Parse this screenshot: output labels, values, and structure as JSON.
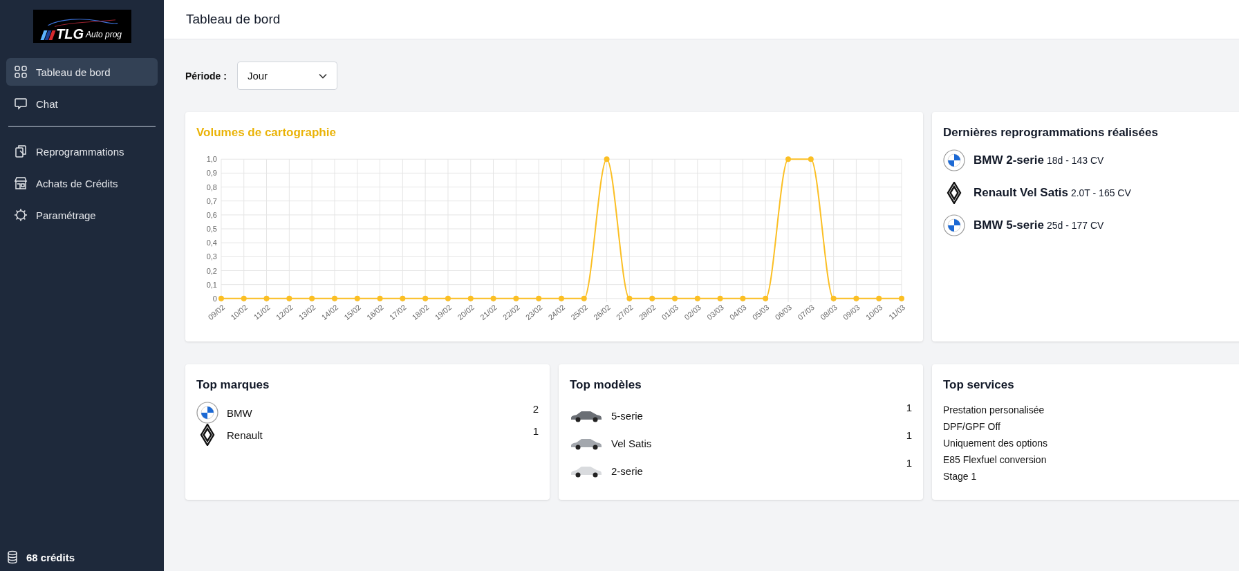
{
  "sidebar": {
    "logo": {
      "brand": "TLG",
      "tagline": "Auto prog"
    },
    "nav_groups": [
      [
        {
          "label": "Tableau de bord",
          "kind": "grid",
          "selected": true
        },
        {
          "label": "Chat",
          "kind": "chat",
          "selected": false
        }
      ],
      [
        {
          "label": "Reprogrammations",
          "kind": "clipboard",
          "selected": false
        },
        {
          "label": "Achats de Crédits",
          "kind": "store",
          "selected": false
        },
        {
          "label": "Paramétrage",
          "kind": "gear",
          "selected": false
        }
      ]
    ],
    "credits": "68 crédits"
  },
  "header": {
    "title": "Tableau de bord"
  },
  "period": {
    "label": "Période :",
    "value": "Jour"
  },
  "volume_card": {
    "title": "Volumes de cartographie",
    "chart_data": {
      "type": "line",
      "categories": [
        "09/02",
        "10/02",
        "11/02",
        "12/02",
        "13/02",
        "14/02",
        "15/02",
        "16/02",
        "17/02",
        "18/02",
        "19/02",
        "20/02",
        "21/02",
        "22/02",
        "23/02",
        "24/02",
        "25/02",
        "26/02",
        "27/02",
        "28/02",
        "01/03",
        "02/03",
        "03/03",
        "04/03",
        "05/03",
        "06/03",
        "07/03",
        "08/03",
        "09/03",
        "10/03",
        "11/03"
      ],
      "grid": true,
      "series": [
        {
          "color": "#fbbf24",
          "marker": true,
          "values": [
            0,
            0,
            0,
            0,
            0,
            0,
            0,
            0,
            0,
            0,
            0,
            0,
            0,
            0,
            0,
            0,
            0,
            1,
            0,
            0,
            0,
            0,
            0,
            0,
            0,
            1,
            1,
            0,
            0,
            0,
            0
          ]
        }
      ],
      "ylim": [
        0,
        1
      ],
      "yticks": [
        {
          "value": 0,
          "label": "0"
        },
        {
          "value": 0.1,
          "label": "0,1"
        },
        {
          "value": 0.2,
          "label": "0,2"
        },
        {
          "value": 0.3,
          "label": "0,3"
        },
        {
          "value": 0.4,
          "label": "0,4"
        },
        {
          "value": 0.5,
          "label": "0,5"
        },
        {
          "value": 0.6,
          "label": "0,6"
        },
        {
          "value": 0.7,
          "label": "0,7"
        },
        {
          "value": 0.8,
          "label": "0,8"
        },
        {
          "value": 0.9,
          "label": "0,9"
        },
        {
          "value": 1,
          "label": "1,0"
        }
      ]
    }
  },
  "recent_card": {
    "title": "Dernières reprogrammations réalisées",
    "items": [
      {
        "kind": "bmw",
        "name": "BMW 2-serie",
        "detail": "18d - 143 CV"
      },
      {
        "kind": "renault",
        "name": "Renault Vel Satis",
        "detail": "2.0T - 165 CV"
      },
      {
        "kind": "bmw",
        "name": "BMW 5-serie",
        "detail": "25d - 177 CV"
      }
    ]
  },
  "top_brands": {
    "title": "Top marques",
    "items": [
      {
        "kind": "bmw",
        "name": "BMW",
        "count": "2"
      },
      {
        "kind": "renault",
        "name": "Renault",
        "count": "1"
      }
    ]
  },
  "top_models": {
    "title": "Top modèles",
    "items": [
      {
        "name": "5-serie",
        "count": "1",
        "color": "#6b6f75"
      },
      {
        "name": "Vel Satis",
        "count": "1",
        "color": "#a3a7ad"
      },
      {
        "name": "2-serie",
        "count": "1",
        "color": "#d9dbde"
      }
    ]
  },
  "top_services": {
    "title": "Top services",
    "items": [
      "Prestation personalisée",
      "DPF/GPF Off",
      "Uniquement des options",
      "E85 Flexfuel conversion",
      "Stage 1"
    ]
  }
}
